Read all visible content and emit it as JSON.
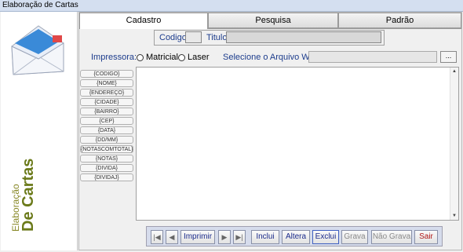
{
  "window": {
    "title": "Elaboração de Cartas"
  },
  "brand": {
    "line1": "Elaboração",
    "line2": "De Cartas"
  },
  "tabs": [
    {
      "label": "Cadastro",
      "active": true
    },
    {
      "label": "Pesquisa",
      "active": false
    },
    {
      "label": "Padrão",
      "active": false
    }
  ],
  "form": {
    "codigo_label": "Codigo:",
    "codigo_value": "",
    "titulo_label": "Titulo:",
    "titulo_value": "",
    "impressora_label": "Impressora:",
    "printer_options": [
      "Matricial",
      "Laser"
    ],
    "word_label": "Selecione o Arquivo Word:",
    "word_value": "",
    "browse_label": "..."
  },
  "tokens": [
    "{CODIGO}",
    "{NOME}",
    "{ENDEREÇO}",
    "{CIDADE}",
    "{BAIRRO}",
    "{CEP}",
    "{DATA}",
    "{DD/MM}",
    "{NOTASCOMTOTAL}",
    "{NOTAS}",
    "{DIVIDA}",
    "{DIVIDAJ}"
  ],
  "toolbar": {
    "first": "|◀",
    "prev": "◀",
    "print": "Imprimir",
    "next": "▶",
    "last": "▶|",
    "include": "Inclui",
    "alter": "Altera",
    "delete": "Exclui",
    "save": "Grava",
    "nosave": "Não Grava",
    "exit": "Sair"
  },
  "colors": {
    "accent": "#1c2c8c",
    "danger": "#b01818",
    "brand": "#6b7a1a"
  }
}
